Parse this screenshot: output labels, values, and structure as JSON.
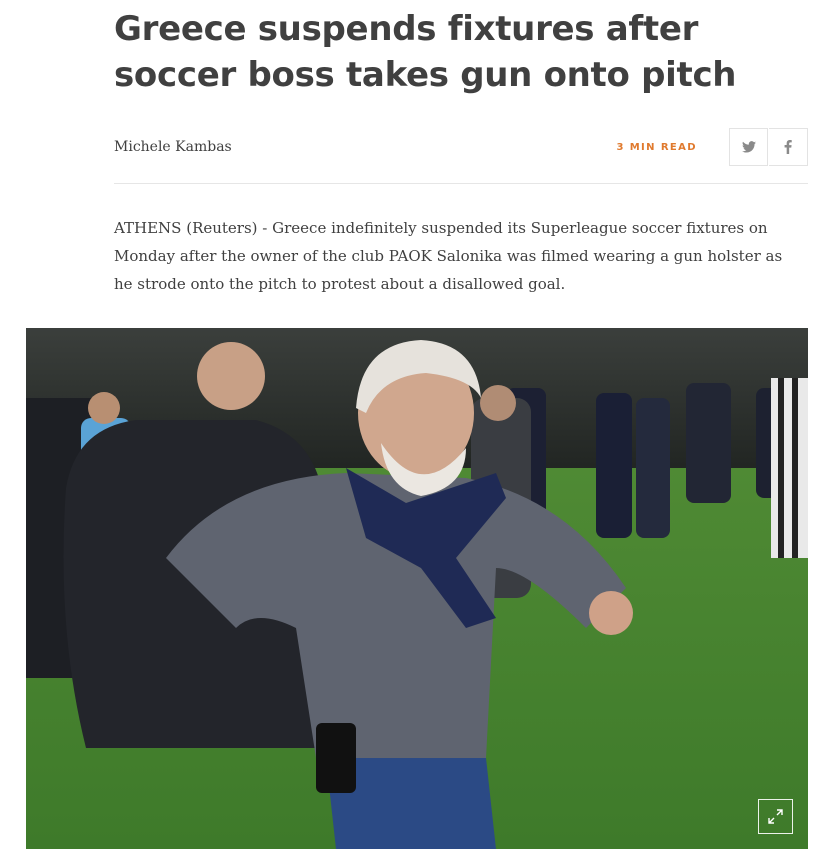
{
  "article": {
    "headline": "Greece suspends fixtures after soccer boss takes gun onto pitch",
    "author": "Michele Kambas",
    "read_time": "3 MIN READ",
    "lede": "ATHENS (Reuters) - Greece indefinitely suspended its Superleague soccer fixtures on Monday after the owner of the club PAOK Salonika was filmed wearing a gun holster as he strode onto the pitch to protest about a disallowed goal."
  },
  "share": {
    "icons": [
      "twitter-icon",
      "facebook-icon"
    ]
  },
  "photo": {
    "description_icon": "expand-icon"
  },
  "colors": {
    "text": "#404040",
    "accent": "#e07a2e",
    "border": "#e3e3e3"
  }
}
